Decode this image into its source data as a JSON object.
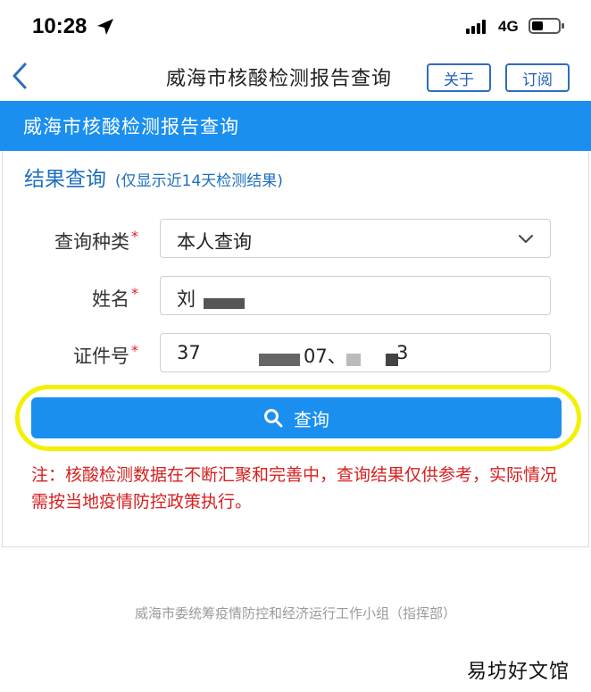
{
  "status_bar": {
    "time": "10:28",
    "network": "4G"
  },
  "nav": {
    "title": "威海市核酸检测报告查询",
    "about_label": "关于",
    "subscribe_label": "订阅"
  },
  "banner": {
    "title": "威海市核酸检测报告查询"
  },
  "result": {
    "title": "结果查询",
    "note": "(仅显示近14天检测结果)"
  },
  "form": {
    "query_type": {
      "label": "查询种类",
      "required_mark": "*",
      "value": "本人查询"
    },
    "name": {
      "label": "姓名",
      "required_mark": "*",
      "value": "刘"
    },
    "id_number": {
      "label": "证件号",
      "required_mark": "*",
      "value_start": "37",
      "value_mid": "07、",
      "value_end": "3"
    }
  },
  "query_button": {
    "label": "查询"
  },
  "notice": "注：核酸检测数据在不断汇聚和完善中，查询结果仅供参考，实际情况需按当地疫情防控政策执行。",
  "footer": "威海市委统筹疫情防控和经济运行工作小组（指挥部）",
  "watermark": "易坊好文馆",
  "colors": {
    "brand_blue": "#1a8ff0",
    "title_blue": "#1f6fc0",
    "warning_red": "#d72020",
    "highlight_yellow": "#f3f000"
  }
}
